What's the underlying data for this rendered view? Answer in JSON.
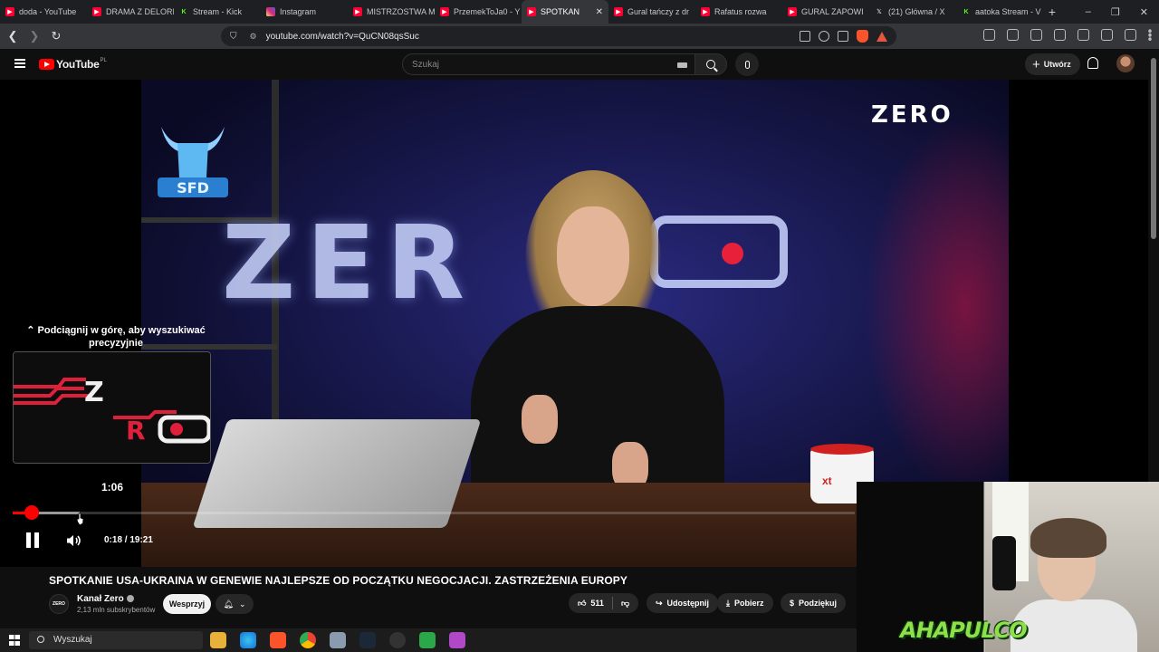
{
  "browser": {
    "tabs": [
      {
        "label": "doda - YouTube",
        "favicon": "youtube",
        "color": "#ff0033"
      },
      {
        "label": "DRAMA Z DELORI",
        "favicon": "youtube",
        "color": "#ff0033"
      },
      {
        "label": "Stream - Kick",
        "favicon": "kick",
        "color": "#53fc18"
      },
      {
        "label": "Instagram",
        "favicon": "instagram",
        "color": "#d62976"
      },
      {
        "label": "MISTRZOSTWA M",
        "favicon": "youtube",
        "color": "#ff0033"
      },
      {
        "label": "PrzemekToJa0 - Y",
        "favicon": "youtube",
        "color": "#ff0033"
      },
      {
        "label": "SPOTKAN",
        "favicon": "youtube",
        "color": "#ff0033",
        "active": true
      },
      {
        "label": "Gural tańczy z dr",
        "favicon": "youtube",
        "color": "#ff0033"
      },
      {
        "label": "Rafatus rozwa",
        "favicon": "youtube",
        "color": "#ff0033"
      },
      {
        "label": "GURAL ZAPOWI",
        "favicon": "youtube",
        "color": "#ff0033"
      },
      {
        "label": "(21) Główna / X",
        "favicon": "x",
        "color": "#ffffff"
      },
      {
        "label": "aatoka Stream - V",
        "favicon": "kick",
        "color": "#53fc18"
      }
    ],
    "new_tab": "+",
    "url": "youtube.com/watch?v=QuCN08qsSuc"
  },
  "youtube": {
    "logo_text": "YouTube",
    "country_code": "PL",
    "search_placeholder": "Szukaj",
    "create_label": "Utwórz"
  },
  "player": {
    "watermark": "ZERO",
    "backdrop_text": "ZER",
    "seek_hint": "⌃ Podciągnij w górę, aby wyszukiwać precyzyjnie",
    "seek_preview_time": "1:06",
    "current_time": "0:18",
    "duration": "19:21",
    "time_display": "0:18 / 19:21",
    "progress_fraction": 0.0223,
    "mug_text": "xt"
  },
  "video": {
    "title": "SPOTKANIE USA-UKRAINA W GENEWIE NAJLEPSZE OD POCZĄTKU NEGOCJACJI. ZASTRZEŻENIA EUROPY",
    "channel_name": "Kanał Zero",
    "channel_avatar_text": "ZERO",
    "subscribers": "2,13 mln subskrybentów",
    "support_label": "Wesprzyj",
    "likes": "511",
    "share_label": "Udostępnij",
    "download_label": "Pobierz",
    "thanks_label": "Podziękuj"
  },
  "stream_overlay": {
    "brand_text": "AHAPULCO"
  },
  "taskbar": {
    "search_placeholder": "Wyszukaj"
  },
  "colors": {
    "yt_red": "#ff0000",
    "bg": "#0f0f0f"
  }
}
